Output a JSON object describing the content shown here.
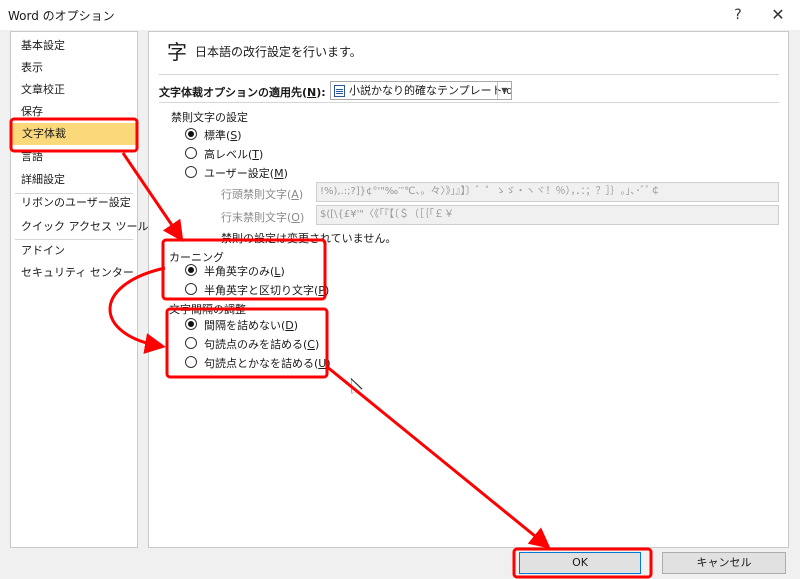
{
  "window": {
    "title": "Word のオプション",
    "help_label": "?",
    "close_label": "✕"
  },
  "sidebar": {
    "items": [
      {
        "label": "基本設定"
      },
      {
        "label": "表示"
      },
      {
        "label": "文章校正"
      },
      {
        "label": "保存"
      },
      {
        "label": "文字体裁"
      },
      {
        "label": "言語"
      },
      {
        "label": "詳細設定"
      },
      {
        "label": "リボンのユーザー設定"
      },
      {
        "label": "クイック アクセス ツール バー"
      },
      {
        "label": "アドイン"
      },
      {
        "label": "セキュリティ センター"
      }
    ],
    "selected_index": 4
  },
  "main": {
    "header_glyph": "字",
    "header_text": "日本語の改行設定を行います。",
    "apply_to": {
      "label_prefix": "文字体裁オプションの適用先(",
      "label_key": "N",
      "label_suffix": "):",
      "selected_file": "小説かなり的確なテンプレート.docx"
    },
    "kinsoku": {
      "title": "禁則文字の設定",
      "options": [
        {
          "prefix": "標準(",
          "key": "S",
          "suffix": ")",
          "checked": true
        },
        {
          "prefix": "高レベル(",
          "key": "T",
          "suffix": ")",
          "checked": false
        },
        {
          "prefix": "ユーザー設定(",
          "key": "M",
          "suffix": ")",
          "checked": false
        }
      ],
      "line_start": {
        "prefix": "行頭禁則文字(",
        "key": "A",
        "suffix": ")",
        "value": "!%),.:;?]}¢°'\"‰′″℃、。々〉》」』】〕゛゜ゝゞ・ヽヾ！％），．：；？］｝｡｣､･ﾞﾟ￠"
      },
      "line_end": {
        "prefix": "行末禁則文字(",
        "key": "O",
        "suffix": ")",
        "value": "$([\\{£¥'\"〈《「『【〔＄（［｛｢￡￥"
      },
      "note": "禁則の設定は変更されていません。"
    },
    "kerning": {
      "title": "カーニング",
      "options": [
        {
          "prefix": "半角英字のみ(",
          "key": "L",
          "suffix": ")",
          "checked": true
        },
        {
          "prefix": "半角英字と区切り文字(",
          "key": "P",
          "suffix": ")",
          "checked": false
        }
      ]
    },
    "spacing": {
      "title": "文字間隔の調整",
      "options": [
        {
          "prefix": "間隔を詰めない(",
          "key": "D",
          "suffix": ")",
          "checked": true
        },
        {
          "prefix": "句読点のみを詰める(",
          "key": "C",
          "suffix": ")",
          "checked": false
        },
        {
          "prefix": "句読点とかなを詰める(",
          "key": "U",
          "suffix": ")",
          "checked": false
        }
      ]
    }
  },
  "footer": {
    "ok_label": "OK",
    "cancel_label": "キャンセル"
  },
  "colors": {
    "highlight_box": "#ff0000",
    "selected_nav": "#fbd97b",
    "ok_border": "#0078d7"
  },
  "icons": {
    "file": "word-document-icon",
    "dropdown": "chevron-down-icon",
    "cursor": "mouse-pointer-icon"
  }
}
